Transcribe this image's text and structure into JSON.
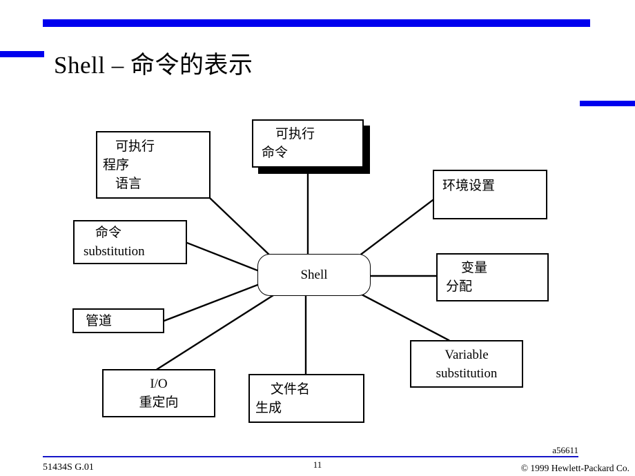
{
  "slide": {
    "title": "Shell – 命令的表示",
    "accent_color": "#0000ee",
    "footer_line_color": "#1414c8"
  },
  "diagram": {
    "type": "mind-map",
    "center": {
      "id": "shell",
      "label": "Shell"
    },
    "nodes": [
      {
        "id": "exec-prog",
        "lines": [
          "可执行",
          "程序",
          "语言"
        ],
        "shadow": false
      },
      {
        "id": "exec-cmd",
        "lines": [
          "可执行",
          "命令"
        ],
        "shadow": true
      },
      {
        "id": "env-setting",
        "lines": [
          "环境设置"
        ],
        "shadow": false
      },
      {
        "id": "var-assign",
        "lines": [
          "变量",
          "分配"
        ],
        "shadow": false
      },
      {
        "id": "var-subst",
        "lines": [
          "Variable",
          "substitution"
        ],
        "shadow": false
      },
      {
        "id": "filename-gen",
        "lines": [
          "文件名",
          "生成"
        ],
        "shadow": false
      },
      {
        "id": "io-redirect",
        "lines": [
          "I/O",
          "重定向"
        ],
        "shadow": false
      },
      {
        "id": "pipe",
        "lines": [
          "管道"
        ],
        "shadow": false
      },
      {
        "id": "cmd-subst",
        "lines": [
          "命令",
          "substitution"
        ],
        "shadow": false
      }
    ]
  },
  "footer": {
    "doc_code": "a56611",
    "course_code": "51434S G.01",
    "page_number": "11",
    "copyright": "© 1999 Hewlett-Packard Co."
  }
}
